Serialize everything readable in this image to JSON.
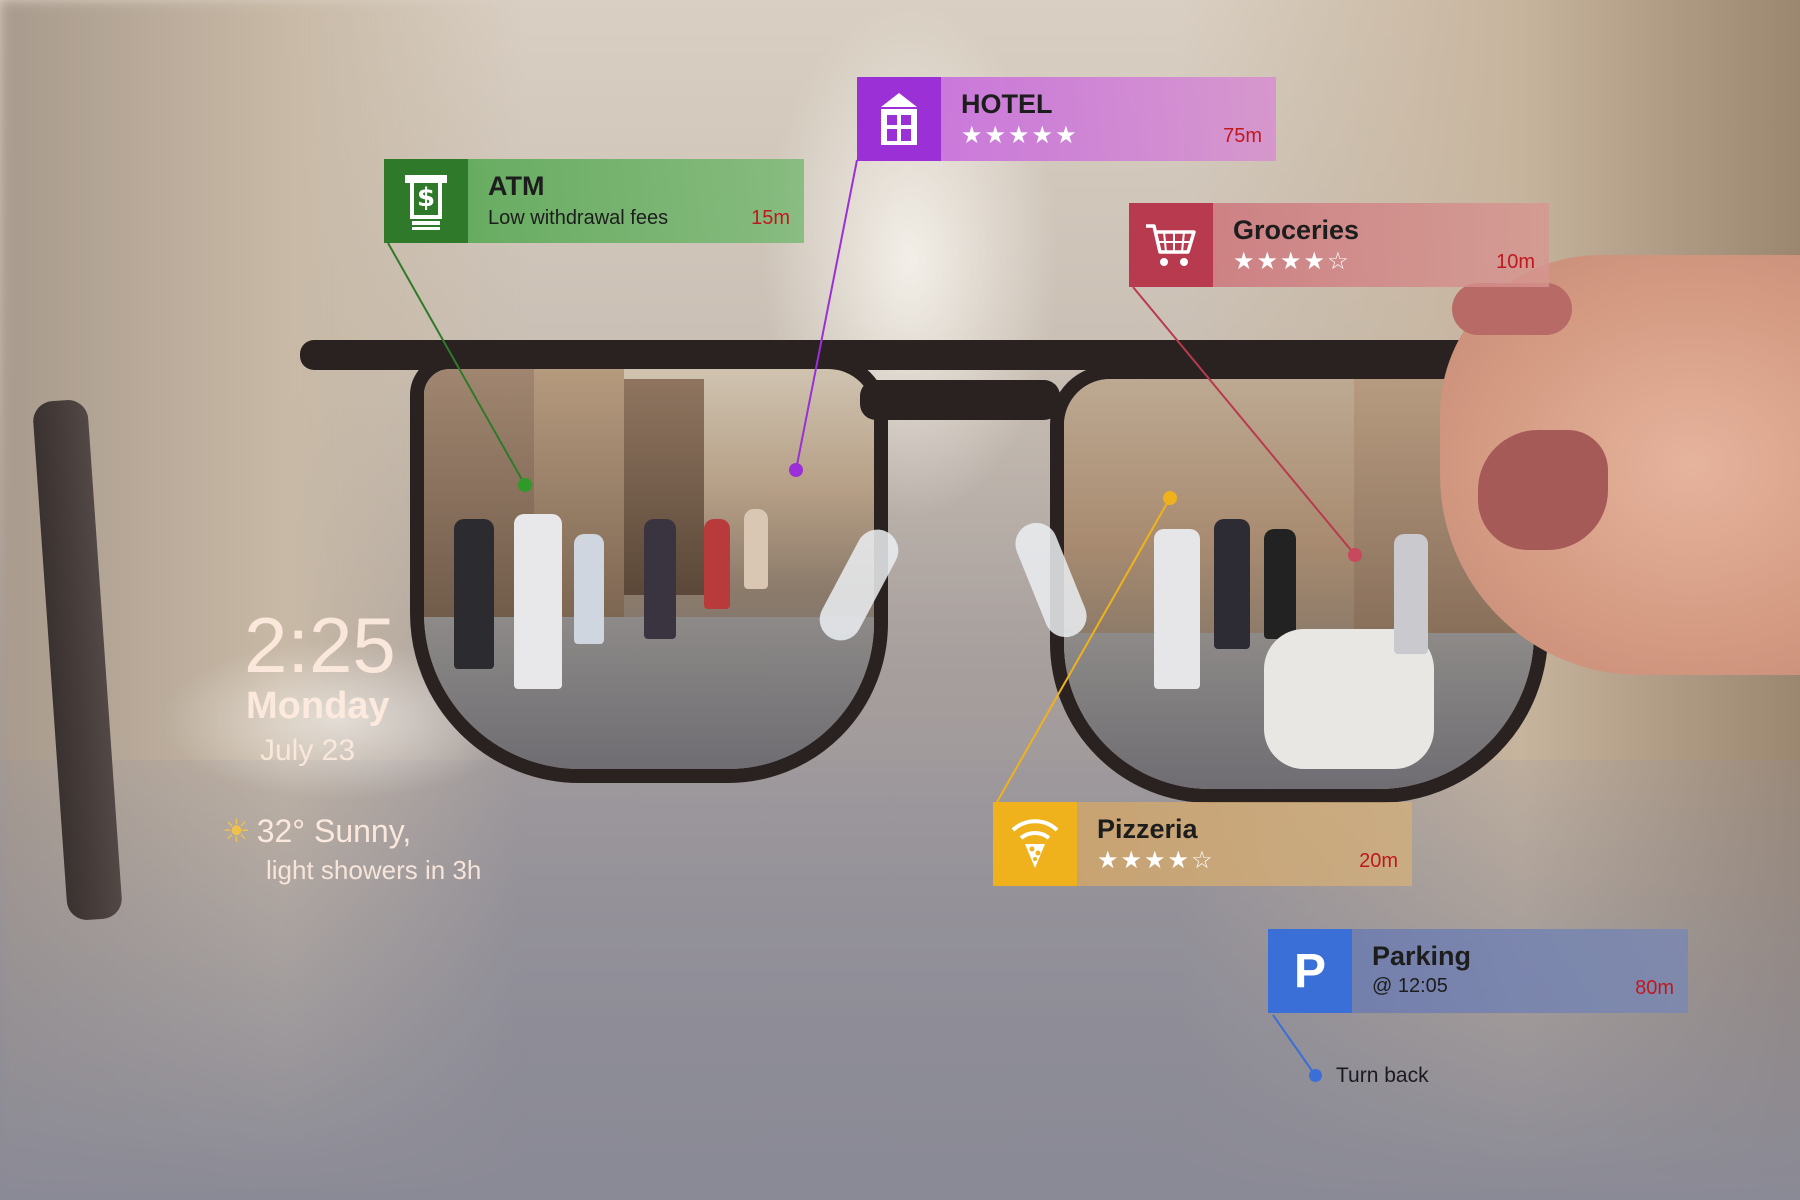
{
  "colors": {
    "atm": "#2f7a2a",
    "hotel": "#9b30d6",
    "groceries": "#b83a4e",
    "pizzeria": "#f0b21c",
    "parking": "#3a6fd8",
    "distance": "#c0181e"
  },
  "hud": {
    "time": "2:25",
    "day": "Monday",
    "date": "July 23",
    "weather": "32° Sunny,",
    "forecast": "light showers in 3h",
    "weather_icon": "sun-icon"
  },
  "pois": {
    "atm": {
      "title": "ATM",
      "subtitle": "Low withdrawal fees",
      "distance": "15m",
      "icon": "atm-dollar-icon"
    },
    "hotel": {
      "title": "HOTEL",
      "rating_stars": "★★★★★",
      "rating": 5,
      "distance": "75m",
      "icon": "hotel-building-icon"
    },
    "groceries": {
      "title": "Groceries",
      "rating_stars": "★★★★☆",
      "rating": 4,
      "distance": "10m",
      "icon": "shopping-cart-icon"
    },
    "pizzeria": {
      "title": "Pizzeria",
      "rating_stars": "★★★★☆",
      "rating": 4,
      "distance": "20m",
      "icon": "pizza-wifi-icon"
    },
    "parking": {
      "title": "Parking",
      "subtitle": "@ 12:05",
      "distance": "80m",
      "icon_letter": "P",
      "icon": "parking-icon"
    }
  },
  "navigation": {
    "turn_back": "Turn back"
  }
}
